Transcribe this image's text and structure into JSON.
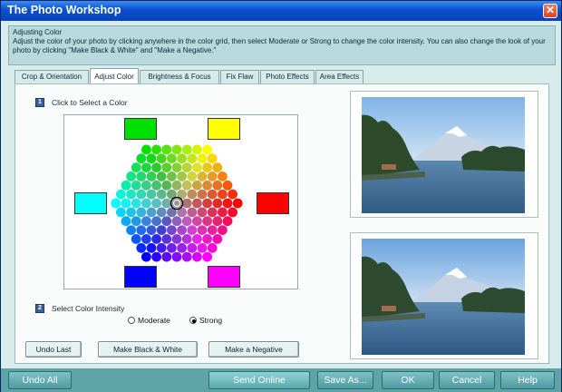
{
  "window": {
    "title": "The Photo Workshop",
    "close_glyph": "✕"
  },
  "info": {
    "title": "Adjusting Color",
    "text": "Adjust the color of your photo by clicking anywhere in the color grid, then select Moderate or Strong to change the color intensity.  You can also change the look of your photo by clicking \"Make Black & White\" and \"Make a Negative.\""
  },
  "tabs": [
    {
      "label": "Crop & Orientation",
      "active": false
    },
    {
      "label": "Adjust Color",
      "active": true
    },
    {
      "label": "Brightness & Focus",
      "active": false
    },
    {
      "label": "Fix Flaw",
      "active": false
    },
    {
      "label": "Photo Effects",
      "active": false
    },
    {
      "label": "Area Effects",
      "active": false
    }
  ],
  "step1": {
    "badge": "1",
    "label": "Click to Select a Color"
  },
  "step2": {
    "badge": "2",
    "label": "Select Color Intensity"
  },
  "intensity": {
    "options": [
      "Moderate",
      "Strong"
    ],
    "selected": "Strong"
  },
  "buttons": {
    "undo_last": "Undo Last",
    "black_white": "Make Black & White",
    "negative": "Make a Negative"
  },
  "bottom": {
    "undo_all": "Undo All",
    "send_online": "Send Online",
    "save_as": "Save As...",
    "ok": "OK",
    "cancel": "Cancel",
    "help": "Help"
  },
  "swatches": {
    "top_left": "#00e000",
    "top_right": "#ffff00",
    "left": "#00ffff",
    "right": "#ff0000",
    "bottom_left": "#0000ff",
    "bottom_right": "#ff00ff"
  },
  "colors": {
    "title_bar": "#0a4fd0",
    "window_bg": "#d9ecec",
    "bottom_bar": "#5ea3a8"
  },
  "icons": {
    "close": "close-icon",
    "selector": "crosshair-icon"
  }
}
